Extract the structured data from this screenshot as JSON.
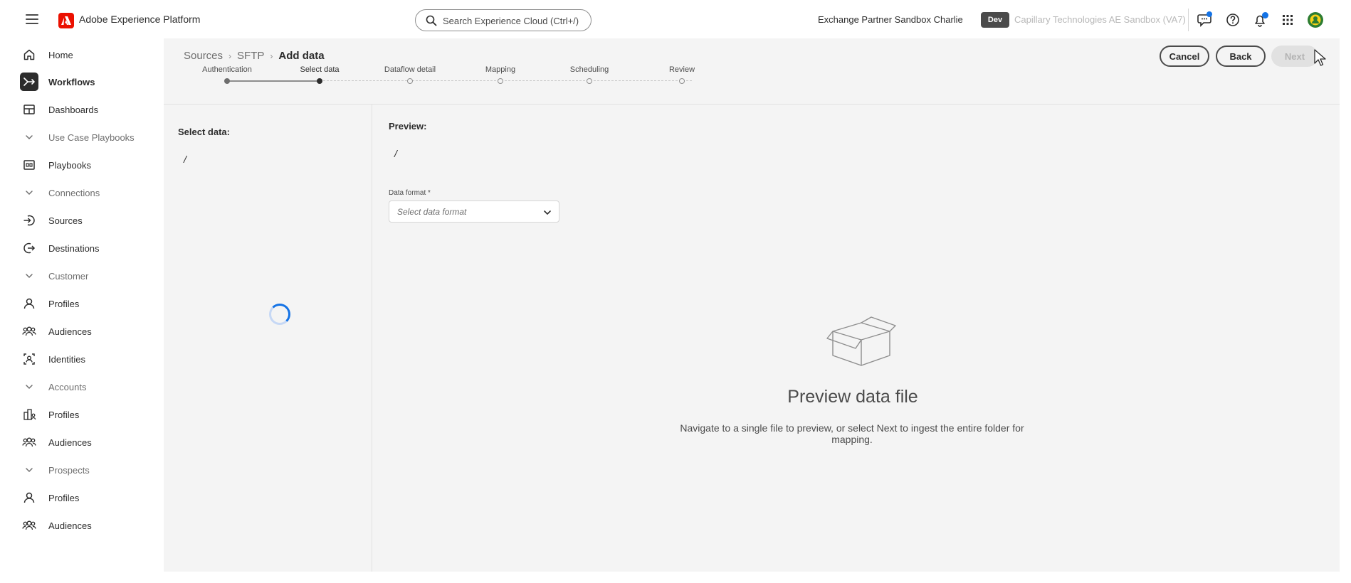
{
  "app": {
    "brand_name": "Adobe Experience Platform",
    "org_name": "Exchange Partner Sandbox Charlie",
    "env_badge": "Dev",
    "sandbox_name": "Capillary Technologies AE Sandbox (VA7)"
  },
  "search": {
    "placeholder": "Search Experience Cloud (Ctrl+/)"
  },
  "sidebar": {
    "items": [
      {
        "label": "Home",
        "icon": "home-icon"
      },
      {
        "label": "Workflows",
        "icon": "workflows-icon",
        "active": true
      },
      {
        "label": "Dashboards",
        "icon": "dashboards-icon"
      },
      {
        "label": "Use Case Playbooks",
        "icon": "chevron-down-icon",
        "section": true
      },
      {
        "label": "Playbooks",
        "icon": "playbooks-icon"
      },
      {
        "label": "Connections",
        "icon": "chevron-down-icon",
        "section": true
      },
      {
        "label": "Sources",
        "icon": "sources-icon"
      },
      {
        "label": "Destinations",
        "icon": "destinations-icon"
      },
      {
        "label": "Customer",
        "icon": "chevron-down-icon",
        "section": true
      },
      {
        "label": "Profiles",
        "icon": "profile-icon"
      },
      {
        "label": "Audiences",
        "icon": "audiences-icon"
      },
      {
        "label": "Identities",
        "icon": "identities-icon"
      },
      {
        "label": "Accounts",
        "icon": "chevron-down-icon",
        "section": true
      },
      {
        "label": "Profiles",
        "icon": "accounts-profile-icon"
      },
      {
        "label": "Audiences",
        "icon": "audiences-icon"
      },
      {
        "label": "Prospects",
        "icon": "chevron-down-icon",
        "section": true
      },
      {
        "label": "Profiles",
        "icon": "profile-icon"
      },
      {
        "label": "Audiences",
        "icon": "audiences-icon"
      }
    ]
  },
  "breadcrumb": {
    "items": [
      "Sources",
      "SFTP"
    ],
    "current": "Add data"
  },
  "actions": {
    "cancel": "Cancel",
    "back": "Back",
    "next": "Next"
  },
  "steps": {
    "items": [
      {
        "label": "Authentication",
        "state": "done"
      },
      {
        "label": "Select data",
        "state": "active"
      },
      {
        "label": "Dataflow detail",
        "state": "todo"
      },
      {
        "label": "Mapping",
        "state": "todo"
      },
      {
        "label": "Scheduling",
        "state": "todo"
      },
      {
        "label": "Review",
        "state": "todo"
      }
    ]
  },
  "select_panel": {
    "title": "Select data:",
    "path": "/"
  },
  "preview_panel": {
    "title": "Preview:",
    "path": "/",
    "data_format_label": "Data format",
    "required_marker": "*",
    "data_format_placeholder": "Select data format"
  },
  "empty_state": {
    "icon": "empty-box-icon",
    "title": "Preview data file",
    "description": "Navigate to a single file to preview, or select Next to ingest the entire folder for mapping."
  },
  "colors": {
    "brand_red": "#eb1000",
    "accent_blue": "#1473e6",
    "panel_bg": "#f4f4f4"
  }
}
